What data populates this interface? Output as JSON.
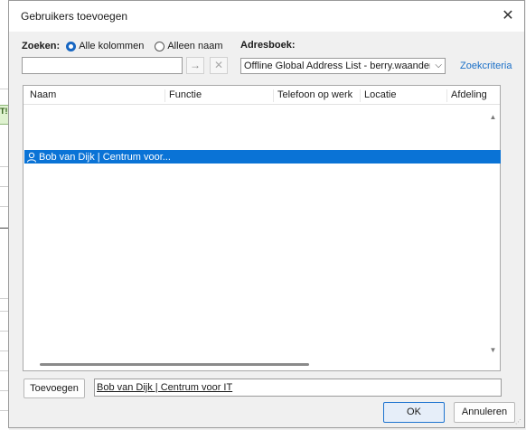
{
  "dialog": {
    "title": "Gebruikers toevoegen",
    "close_glyph": "✕"
  },
  "search": {
    "label": "Zoeken:",
    "option_all": "Alle kolommen",
    "option_name": "Alleen naam",
    "selected_option": "Alle kolommen",
    "value": "",
    "go_glyph": "→",
    "clear_glyph": "✕"
  },
  "address_book": {
    "label": "Adresboek:",
    "selected": "Offline Global Address List - berry.waanders",
    "chevron": "⌵",
    "advanced_link": "Zoekcriteria"
  },
  "table": {
    "columns": [
      "Naam",
      "Functie",
      "Telefoon op werk",
      "Locatie",
      "Afdeling"
    ],
    "rows": [
      {
        "naam": "Bob van Dijk | Centrum voor...",
        "selected": true
      }
    ],
    "scroll_up_glyph": "▲",
    "scroll_down_glyph": "▼"
  },
  "footer": {
    "add_button": "Toevoegen",
    "recipients": "Bob van Dijk | Centrum voor IT",
    "ok_button": "OK",
    "cancel_button": "Annuleren"
  },
  "background": {
    "fragment": "T!"
  },
  "colors": {
    "selection": "#0a73d6",
    "link": "#1a6fc7",
    "accent": "#1766c2"
  },
  "icons": [
    "close-icon",
    "arrow-right-icon",
    "clear-icon",
    "chevron-down-icon",
    "person-icon",
    "scroll-up-icon",
    "scroll-down-icon"
  ]
}
